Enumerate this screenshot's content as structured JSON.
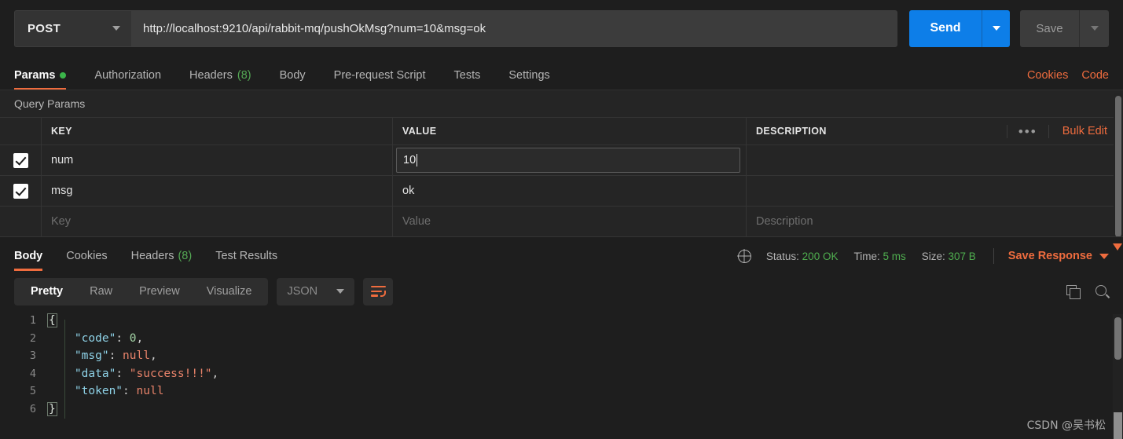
{
  "request": {
    "method": "POST",
    "url": "http://localhost:9210/api/rabbit-mq/pushOkMsg?num=10&msg=ok",
    "send_label": "Send",
    "save_label": "Save",
    "tabs": [
      {
        "label": "Params",
        "active": true,
        "dot": true
      },
      {
        "label": "Authorization",
        "active": false
      },
      {
        "label": "Headers",
        "count": "(8)",
        "active": false
      },
      {
        "label": "Body",
        "active": false
      },
      {
        "label": "Pre-request Script",
        "active": false
      },
      {
        "label": "Tests",
        "active": false
      },
      {
        "label": "Settings",
        "active": false
      }
    ],
    "cookies_link": "Cookies",
    "code_link": "Code"
  },
  "query_params": {
    "section_title": "Query Params",
    "columns": {
      "key": "KEY",
      "value": "VALUE",
      "description": "DESCRIPTION"
    },
    "bulk_edit": "Bulk Edit",
    "more_dots": "•••",
    "rows": [
      {
        "checked": true,
        "key": "num",
        "value": "10",
        "description": "",
        "focused": true
      },
      {
        "checked": true,
        "key": "msg",
        "value": "ok",
        "description": "",
        "focused": false
      }
    ],
    "placeholder_row": {
      "key": "Key",
      "value": "Value",
      "description": "Description"
    }
  },
  "response": {
    "tabs": [
      {
        "label": "Body",
        "active": true
      },
      {
        "label": "Cookies",
        "active": false
      },
      {
        "label": "Headers",
        "count": "(8)",
        "active": false
      },
      {
        "label": "Test Results",
        "active": false
      }
    ],
    "status_label": "Status:",
    "status_value": "200 OK",
    "time_label": "Time:",
    "time_value": "5 ms",
    "size_label": "Size:",
    "size_value": "307 B",
    "save_response": "Save Response",
    "view_modes": [
      {
        "label": "Pretty",
        "active": true
      },
      {
        "label": "Raw",
        "active": false
      },
      {
        "label": "Preview",
        "active": false
      },
      {
        "label": "Visualize",
        "active": false
      }
    ],
    "format": "JSON",
    "line_numbers": [
      "1",
      "2",
      "3",
      "4",
      "5",
      "6"
    ],
    "body_lines": [
      {
        "n": "1",
        "open_brace": "{"
      },
      {
        "n": "2",
        "key": "\"code\"",
        "colon": ": ",
        "num": "0",
        "comma": ","
      },
      {
        "n": "3",
        "key": "\"msg\"",
        "colon": ": ",
        "null": "null",
        "comma": ","
      },
      {
        "n": "4",
        "key": "\"data\"",
        "colon": ": ",
        "str": "\"success!!!\"",
        "comma": ","
      },
      {
        "n": "5",
        "key": "\"token\"",
        "colon": ": ",
        "null": "null",
        "comma": ""
      },
      {
        "n": "6",
        "close_brace": "}"
      }
    ]
  },
  "watermark": "CSDN @吴书松",
  "colors": {
    "accent_orange": "#ef6c3e",
    "send_blue": "#0d7ee8",
    "status_green": "#4fae4f",
    "dot_green": "#3bb54a",
    "bg": "#1e1e1e"
  }
}
